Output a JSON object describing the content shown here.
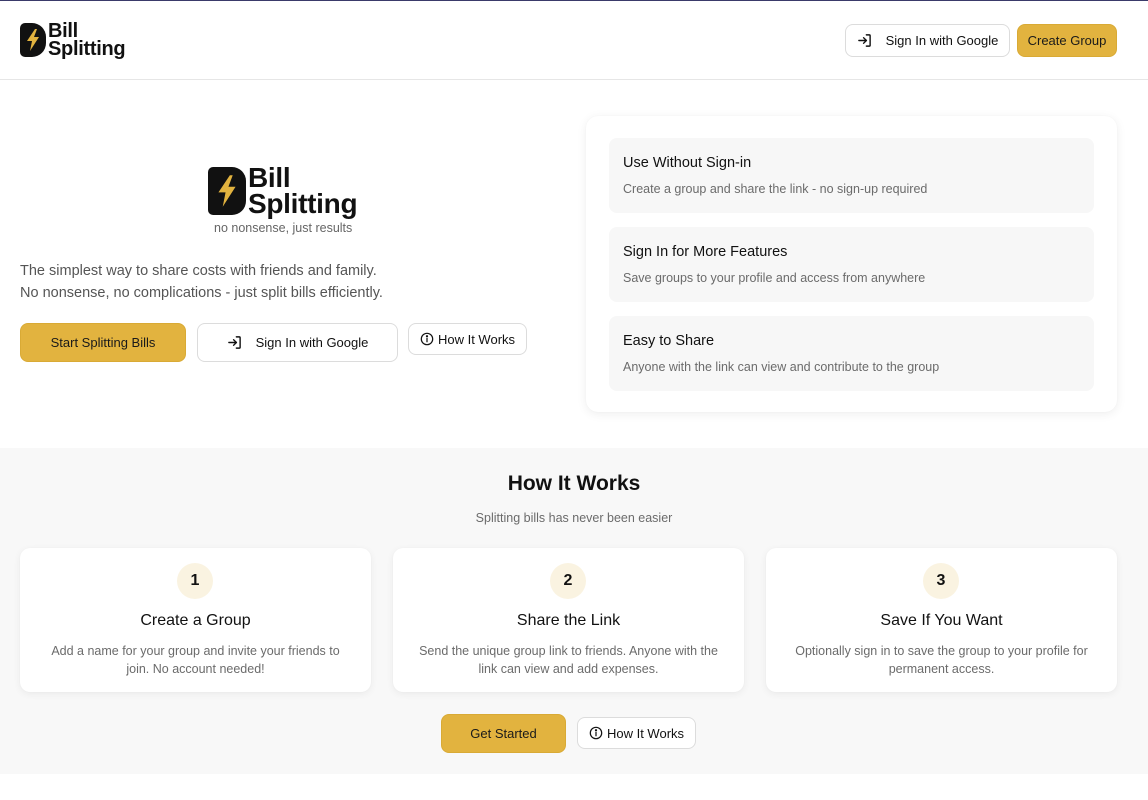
{
  "colors": {
    "accent": "#e2b33f",
    "text": "#111111",
    "muted": "#6b6b6b",
    "section_bg": "#f8f8f8",
    "card_bg": "#f7f7f7"
  },
  "brand": {
    "line1": "Bill",
    "line2": "Splitting",
    "tagline": "no nonsense, just results",
    "icon": "lightning-bolt-icon"
  },
  "header": {
    "signin_label": "Sign In with Google",
    "create_group_label": "Create Group"
  },
  "hero": {
    "description_line1": "The simplest way to share costs with friends and family.",
    "description_line2": "No nonsense, no complications - just split bills efficiently.",
    "start_label": "Start Splitting Bills",
    "signin_label": "Sign In with Google",
    "how_label": "How It Works"
  },
  "features": [
    {
      "title": "Use Without Sign-in",
      "text": "Create a group and share the link - no sign-up required"
    },
    {
      "title": "Sign In for More Features",
      "text": "Save groups to your profile and access from anywhere"
    },
    {
      "title": "Easy to Share",
      "text": "Anyone with the link can view and contribute to the group"
    }
  ],
  "how": {
    "title": "How It Works",
    "subtitle": "Splitting bills has never been easier",
    "steps": [
      {
        "num": "1",
        "title": "Create a Group",
        "text": "Add a name for your group and invite your friends to join. No account needed!"
      },
      {
        "num": "2",
        "title": "Share the Link",
        "text": "Send the unique group link to friends. Anyone with the link can view and add expenses."
      },
      {
        "num": "3",
        "title": "Save If You Want",
        "text": "Optionally sign in to save the group to your profile for permanent access."
      }
    ],
    "get_started_label": "Get Started",
    "how_label": "How It Works"
  }
}
